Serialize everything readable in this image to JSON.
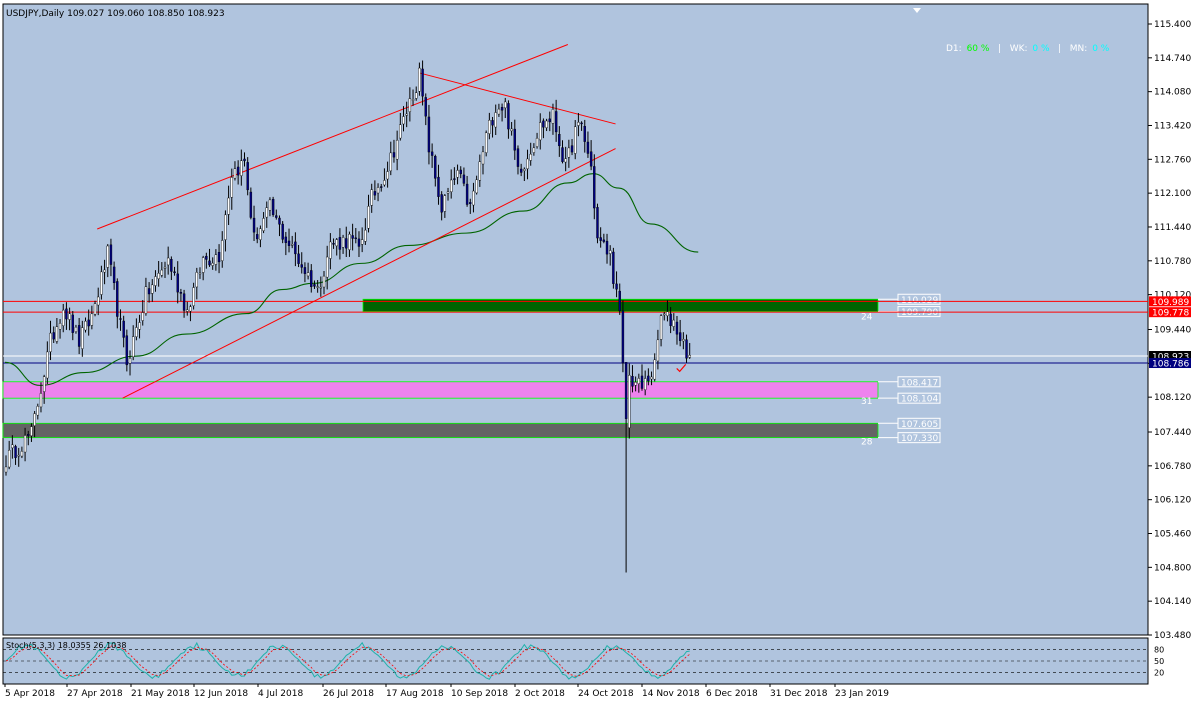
{
  "symbol_header": "USDJPY,Daily  109.027 109.060 108.850 108.923",
  "hud": {
    "d1_label": "D1:",
    "d1_value": "60 %",
    "wk_label": "WK:",
    "wk_value": "0 %",
    "mn_label": "MN:",
    "mn_value": "0 %",
    "separator": "|"
  },
  "colors": {
    "background": "#b0c4de",
    "bull": "#ffffff",
    "bear": "#000080",
    "trendline": "#ff0000",
    "ma": "#006400",
    "green_zone": "#006400",
    "pink_zone": "#ee82ee",
    "grey_zone": "#646464",
    "hud_green": "#00ff00",
    "hud_cyan": "#00ffff"
  },
  "chart_data": {
    "type": "candlestick",
    "instrument": "USDJPY",
    "timeframe": "Daily",
    "ylim": [
      103.48,
      115.79
    ],
    "y_ticks": [
      "115.400",
      "114.740",
      "114.080",
      "113.420",
      "112.760",
      "112.100",
      "111.440",
      "110.780",
      "110.120",
      "109.440",
      "108.780",
      "108.120",
      "107.440",
      "106.780",
      "106.120",
      "105.460",
      "104.800",
      "104.140",
      "103.480"
    ],
    "x_ticks": [
      "5 Apr 2018",
      "27 Apr 2018",
      "21 May 2018",
      "12 Jun 2018",
      "4 Jul 2018",
      "26 Jul 2018",
      "17 Aug 2018",
      "10 Sep 2018",
      "2 Oct 2018",
      "24 Oct 2018",
      "14 Nov 2018",
      "6 Dec 2018",
      "31 Dec 2018",
      "23 Jan 2019"
    ],
    "anchors": [
      [
        "2018-04-05",
        106.9
      ],
      [
        "2018-04-10",
        107.1
      ],
      [
        "2018-04-17",
        107.4
      ],
      [
        "2018-04-25",
        109.2
      ],
      [
        "2018-05-01",
        109.9
      ],
      [
        "2018-05-08",
        109.2
      ],
      [
        "2018-05-14",
        109.7
      ],
      [
        "2018-05-21",
        110.9
      ],
      [
        "2018-05-25",
        109.5
      ],
      [
        "2018-05-29",
        108.8
      ],
      [
        "2018-06-06",
        110.1
      ],
      [
        "2018-06-15",
        110.8
      ],
      [
        "2018-06-25",
        109.8
      ],
      [
        "2018-07-02",
        110.8
      ],
      [
        "2018-07-09",
        110.9
      ],
      [
        "2018-07-13",
        112.5
      ],
      [
        "2018-07-19",
        112.7
      ],
      [
        "2018-07-24",
        111.2
      ],
      [
        "2018-07-31",
        111.8
      ],
      [
        "2018-08-06",
        111.3
      ],
      [
        "2018-08-13",
        110.8
      ],
      [
        "2018-08-21",
        110.2
      ],
      [
        "2018-08-27",
        111.1
      ],
      [
        "2018-09-04",
        111.2
      ],
      [
        "2018-09-07",
        111.0
      ],
      [
        "2018-09-13",
        112.0
      ],
      [
        "2018-09-20",
        112.6
      ],
      [
        "2018-09-28",
        113.7
      ],
      [
        "2018-10-04",
        114.4
      ],
      [
        "2018-10-09",
        113.0
      ],
      [
        "2018-10-15",
        111.8
      ],
      [
        "2018-10-22",
        112.5
      ],
      [
        "2018-10-26",
        111.8
      ],
      [
        "2018-11-02",
        113.2
      ],
      [
        "2018-11-07",
        113.8
      ],
      [
        "2018-11-12",
        113.8
      ],
      [
        "2018-11-16",
        112.6
      ],
      [
        "2018-11-20",
        112.7
      ],
      [
        "2018-11-27",
        113.4
      ],
      [
        "2018-12-03",
        113.6
      ],
      [
        "2018-12-07",
        112.6
      ],
      [
        "2018-12-12",
        113.3
      ],
      [
        "2018-12-14",
        113.4
      ],
      [
        "2018-12-19",
        112.6
      ],
      [
        "2018-12-21",
        111.2
      ],
      [
        "2018-12-27",
        110.9
      ],
      [
        "2019-01-01",
        109.7
      ],
      [
        "2019-01-03",
        107.6
      ],
      [
        "2019-01-04",
        108.5
      ],
      [
        "2019-01-10",
        108.3
      ],
      [
        "2019-01-16",
        108.7
      ],
      [
        "2019-01-18",
        109.7
      ],
      [
        "2019-01-24",
        109.6
      ],
      [
        "2019-01-28",
        109.3
      ],
      [
        "2019-01-31",
        108.9
      ]
    ],
    "highlight_bars": [
      {
        "date": "2019-01-03",
        "open": 108.8,
        "high": 108.8,
        "low": 104.7,
        "close": 107.7
      }
    ],
    "moving_average": [
      [
        "2018-04-05",
        108.8
      ],
      [
        "2018-04-20",
        108.35
      ],
      [
        "2018-05-10",
        108.6
      ],
      [
        "2018-06-01",
        108.92
      ],
      [
        "2018-06-25",
        109.35
      ],
      [
        "2018-07-20",
        109.75
      ],
      [
        "2018-08-05",
        110.22
      ],
      [
        "2018-08-20",
        110.34
      ],
      [
        "2018-09-10",
        110.73
      ],
      [
        "2018-10-01",
        111.08
      ],
      [
        "2018-10-25",
        111.32
      ],
      [
        "2018-11-20",
        111.75
      ],
      [
        "2018-12-10",
        112.3
      ],
      [
        "2018-12-20",
        112.48
      ],
      [
        "2019-01-01",
        112.2
      ],
      [
        "2019-01-15",
        111.5
      ],
      [
        "2019-02-05",
        110.95
      ]
    ],
    "trendlines": [
      {
        "from": [
          "2018-05-16",
          111.4
        ],
        "to": [
          "2018-12-10",
          115.0
        ]
      },
      {
        "from": [
          "2018-05-28",
          108.1
        ],
        "to": [
          "2018-12-29",
          112.97
        ]
      },
      {
        "from": [
          "2018-10-04",
          114.45
        ],
        "to": [
          "2018-12-29",
          113.45
        ]
      }
    ],
    "horizontal_levels": [
      {
        "value": 109.989,
        "label": "109.989",
        "kind": "tag-red"
      },
      {
        "value": 109.778,
        "label": "109.778",
        "kind": "tag-red"
      },
      {
        "value": 108.923,
        "label": "108.923",
        "kind": "tag-black"
      },
      {
        "value": 108.786,
        "label": "108.786",
        "kind": "tag-blue"
      }
    ],
    "zones": [
      {
        "label_high": "110.029",
        "label_low": "109.790",
        "high": 110.03,
        "low": 109.79,
        "count": "24",
        "color": "green"
      },
      {
        "label_high": "108.417",
        "label_low": "108.104",
        "high": 108.42,
        "low": 108.1,
        "count": "31",
        "color": "pink"
      },
      {
        "label_high": "107.605",
        "label_low": "107.330",
        "high": 107.61,
        "low": 107.33,
        "count": "28",
        "color": "grey"
      }
    ],
    "stochastic": {
      "title": "Stoch(5,3,3) 18.0355 26.1038",
      "levels": [
        80,
        50,
        20
      ],
      "level_labels": [
        "80",
        "50",
        "20"
      ]
    }
  }
}
